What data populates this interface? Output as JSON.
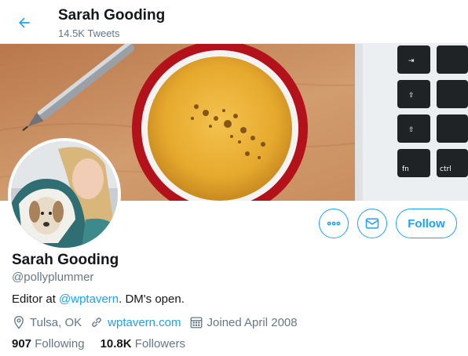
{
  "header": {
    "name": "Sarah Gooding",
    "tweet_count": "14.5K Tweets"
  },
  "profile": {
    "name": "Sarah Gooding",
    "handle": "@pollyplummer",
    "bio": {
      "prefix": "Editor at ",
      "mention": "@wptavern",
      "suffix": ". DM's open."
    },
    "location": "Tulsa, OK",
    "website": "wptavern.com",
    "joined": "Joined April 2008",
    "following_count": "907",
    "following_label": "Following",
    "followers_count": "10.8K",
    "followers_label": "Followers"
  },
  "actions": {
    "follow_label": "Follow",
    "more_icon": "more-icon",
    "message_icon": "envelope-icon"
  },
  "colors": {
    "accent": "#1da1f2",
    "secondary_text": "#657786",
    "primary_text": "#14171a"
  }
}
